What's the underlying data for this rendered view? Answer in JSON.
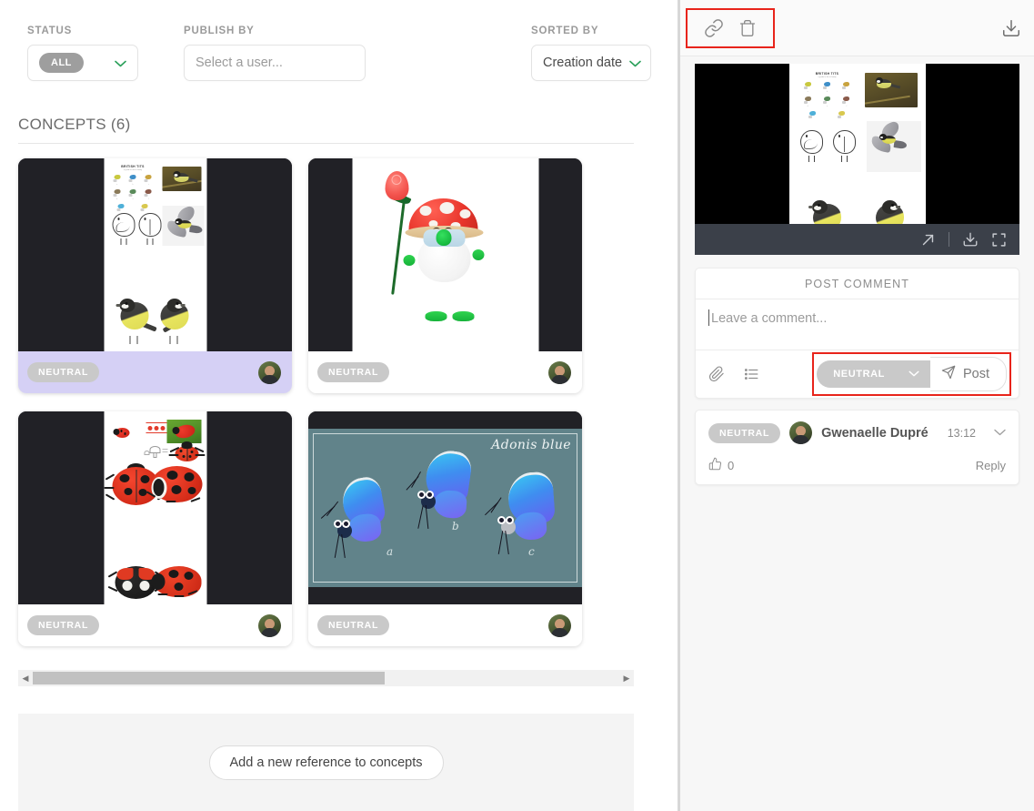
{
  "filters": {
    "status": {
      "label": "STATUS",
      "value": "ALL"
    },
    "publish_by": {
      "label": "PUBLISH BY",
      "placeholder": "Select a user..."
    },
    "sorted_by": {
      "label": "SORTED BY",
      "value": "Creation date"
    }
  },
  "concepts": {
    "section_title": "CONCEPTS (6)",
    "cards": [
      {
        "badge": "NEUTRAL",
        "art": "birds",
        "selected": true
      },
      {
        "badge": "NEUTRAL",
        "art": "gnome",
        "selected": false
      },
      {
        "badge": "NEUTRAL",
        "art": "ladybugs",
        "selected": false
      },
      {
        "badge": "NEUTRAL",
        "art": "butterflies",
        "selected": false
      }
    ],
    "butterfly_board": {
      "title": "Adonis blue",
      "labels": [
        "a",
        "b",
        "c"
      ]
    }
  },
  "scrollbar": {
    "left_arrow": "◀",
    "right_arrow": "▶"
  },
  "dropzone": {
    "add_button": "Add a new reference to concepts"
  },
  "preview": {
    "toolbar": {
      "link_icon": "link-icon",
      "trash_icon": "trash-icon",
      "download_icon": "download-icon"
    },
    "viewer_bar": {
      "expand_icon": "open-external-icon",
      "download_icon": "download-icon",
      "fullscreen_icon": "fullscreen-icon"
    }
  },
  "comment_form": {
    "header": "POST COMMENT",
    "placeholder": "Leave a comment...",
    "attach_icon": "paperclip-icon",
    "list_icon": "list-icon",
    "sentiment": "NEUTRAL",
    "post_label": "Post"
  },
  "comments": [
    {
      "badge": "NEUTRAL",
      "author": "Gwenaelle Dupré",
      "time": "13:12",
      "likes": "0",
      "reply_label": "Reply"
    }
  ],
  "colors": {
    "selected_card": "#d5d0f5",
    "highlight_outline": "#e8241b",
    "accent_green": "#2aa05a",
    "badge_grey": "#c9c9c9"
  }
}
